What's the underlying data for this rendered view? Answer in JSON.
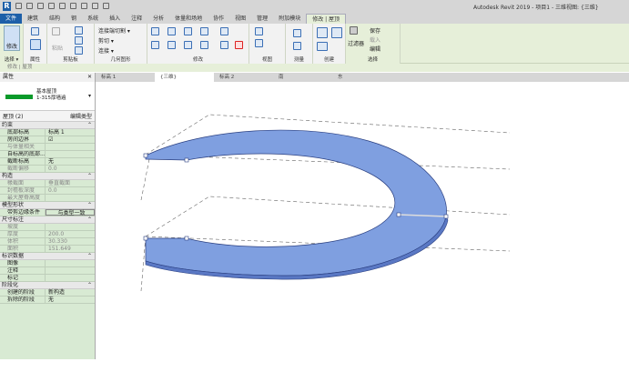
{
  "app": {
    "title": "Autodesk Revit 2019 - 项目1 - 三维视图: {三维}"
  },
  "ribbon_tabs": [
    "文件",
    "建筑",
    "结构",
    "钢",
    "系统",
    "插入",
    "注释",
    "分析",
    "体量和场地",
    "协作",
    "视图",
    "管理",
    "附加模块",
    "修改 | 屋顶"
  ],
  "ribbon": {
    "panels": [
      "选择 ▾",
      "属性",
      "剪贴板",
      "几何图形",
      "修改",
      "视图",
      "测量",
      "创建",
      "选择"
    ],
    "modify_label": "修改",
    "paste_label": "粘贴",
    "geometry_items": [
      "连接端切割 ▾",
      "剪切 ▾",
      "连接 ▾"
    ],
    "filter_label": "过滤器",
    "selection_items": [
      "保存",
      "载入",
      "编辑"
    ]
  },
  "context_bar": "修改 | 屋顶",
  "view_tabs": [
    {
      "label": "标高 1"
    },
    {
      "label": "{三维}"
    },
    {
      "label": "标高 2"
    },
    {
      "label": "南"
    },
    {
      "label": "东"
    }
  ],
  "properties": {
    "title": "属性",
    "type_name": "基本屋顶",
    "type_sub": "1-315厚墙遍",
    "filter": "屋顶 (2)",
    "edit_type": "编辑类型",
    "groups": [
      {
        "name": "约束",
        "rows": [
          [
            "底部标高",
            "标高 1"
          ],
          [
            "房间边界",
            "☑"
          ],
          [
            "与体量相关",
            ""
          ],
          [
            "自标高的底部...",
            ""
          ],
          [
            "截断标高",
            "无"
          ],
          [
            "截断偏移",
            "0.0"
          ]
        ]
      },
      {
        "name": "构造",
        "rows": [
          [
            "椽截面",
            "垂直截面"
          ],
          [
            "封檐板深度",
            "0.0"
          ],
          [
            "最大屋脊高度",
            ""
          ]
        ]
      },
      {
        "name": "模型形状",
        "rows": [
          [
            "带剪边缘条件",
            "与类型一致"
          ]
        ]
      },
      {
        "name": "尺寸标注",
        "rows": [
          [
            "坡度",
            ""
          ],
          [
            "厚度",
            "200.0"
          ],
          [
            "体积",
            "30.330"
          ],
          [
            "面积",
            "151.649"
          ]
        ]
      },
      {
        "name": "标识数据",
        "rows": [
          [
            "图像",
            ""
          ],
          [
            "注释",
            ""
          ],
          [
            "标记",
            ""
          ]
        ]
      },
      {
        "name": "阶段化",
        "rows": [
          [
            "创建的阶段",
            "新构造"
          ],
          [
            "拆除的阶段",
            "无"
          ]
        ]
      }
    ]
  },
  "colors": {
    "roof": "#7f9fe0",
    "accent": "#1d5fa8",
    "ribbon": "#e6efd9",
    "panel": "#d8ead3"
  }
}
